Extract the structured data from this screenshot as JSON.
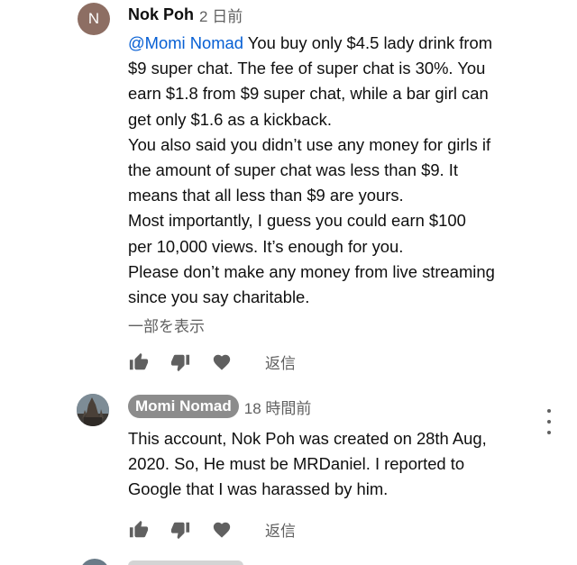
{
  "comments": [
    {
      "avatar_letter": "N",
      "author": "Nok Poh",
      "time": "2 日前",
      "mention": "@Momi Nomad",
      "lines": [
        " You buy only $4.5 lady drink from",
        "$9 super chat. The fee of super chat is 30%. You",
        "earn $1.8 from $9 super chat, while a bar girl can",
        "get only $1.6 as a kickback.",
        "You also said you didn’t use any money for girls if",
        "the amount of super chat was less than $9. It",
        "means that all less than $9 are yours.",
        "Most importantly, I guess you could earn $100",
        "per 10,000 views. It’s enough for you.",
        "Please don’t make any money from live streaming",
        "since you say charitable."
      ],
      "read_more": "一部を表示",
      "reply_label": "返信",
      "icons": [
        "thumbs-up-icon",
        "thumbs-down-icon",
        "heart-icon"
      ]
    },
    {
      "author": "Momi Nomad",
      "time": "18 時間前",
      "lines": [
        "This account, Nok Poh was created on 28th Aug,",
        "2020. So, He must be MRDaniel. I reported to",
        "Google that I was harassed by him."
      ],
      "reply_label": "返信",
      "icons": [
        "thumbs-up-icon",
        "thumbs-down-icon",
        "heart-icon",
        "more-vert-icon"
      ]
    }
  ],
  "colors": {
    "mention": "#065fd4",
    "secondary_text": "#606060",
    "author_pill": "#8c8c8c",
    "avatar_n": "#8d6e63"
  }
}
